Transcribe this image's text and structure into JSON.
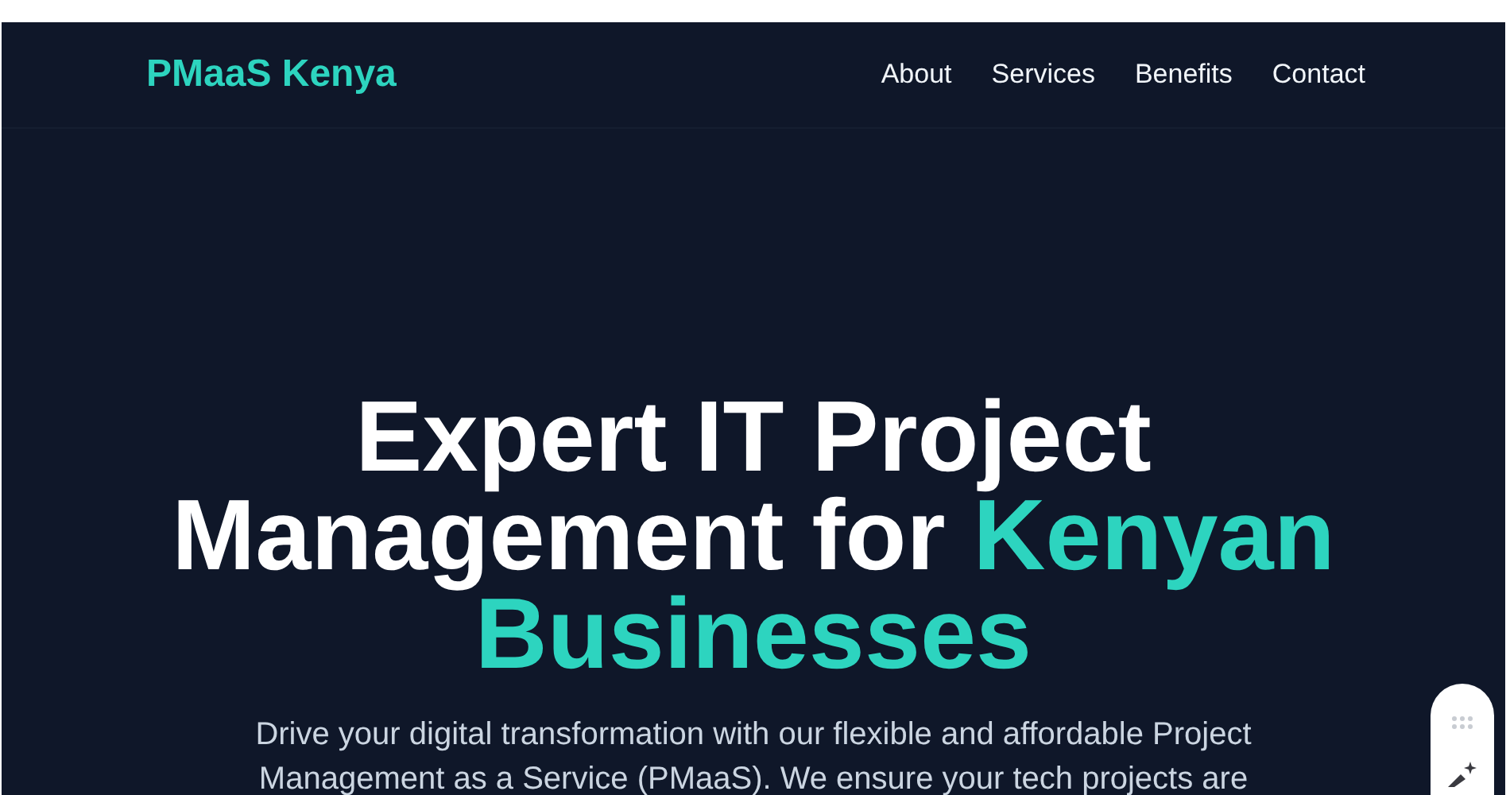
{
  "header": {
    "logo": "PMaaS Kenya",
    "nav": [
      {
        "label": "About"
      },
      {
        "label": "Services"
      },
      {
        "label": "Benefits"
      },
      {
        "label": "Contact"
      }
    ]
  },
  "hero": {
    "heading": "Expert IT Project Management for **Kenyan Businesses**",
    "lines": [
      "Drive your digital transformation with our flexible and affordable Project",
      "Management as a Service (PMaaS). We ensure your tech projects are"
    ]
  }
}
